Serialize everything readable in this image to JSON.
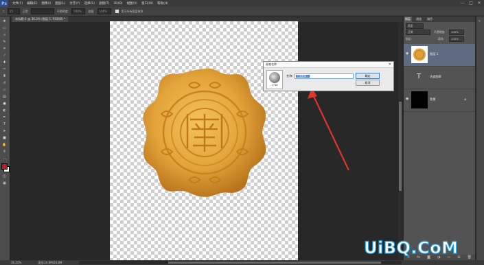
{
  "app": {
    "logo": "Ps"
  },
  "menu": [
    "文件(F)",
    "编辑(E)",
    "图像(I)",
    "图层(L)",
    "文字(Y)",
    "选择(S)",
    "滤镜(T)",
    "3D(D)",
    "视图(V)",
    "窗口(W)",
    "帮助(H)"
  ],
  "window_controls": [
    "—",
    "□",
    "✕"
  ],
  "options_bar": {
    "preset": "15",
    "mode_label": "正常",
    "opacity_label": "不透明度:",
    "opacity_value": "100%",
    "flow_label": "流量:",
    "flow_value": "100%",
    "checkbox_label": "用于所有图层取样"
  },
  "document_tab": {
    "title": "未标题-1 @ 36.2% (图层 1, RGB/8) *"
  },
  "tools": [
    "move",
    "marquee",
    "lasso",
    "quick-select",
    "crop",
    "eyedropper",
    "heal",
    "brush",
    "stamp",
    "history",
    "eraser",
    "gradient",
    "blur",
    "dodge",
    "pen",
    "type",
    "path-select",
    "shape",
    "hand",
    "zoom",
    "more"
  ],
  "colors": {
    "foreground": "#c8141e",
    "background": "#ffffff",
    "arrow": "#e0352b",
    "watermark_stroke": "#1aa0e6"
  },
  "status": {
    "zoom": "36.25%",
    "doc": "文档:24.9M/26.8M"
  },
  "panel": {
    "tabs": [
      "图层",
      "通道",
      "路径"
    ],
    "filter_label": "类型",
    "blend_mode": "正常",
    "opacity_label": "不透明度:",
    "opacity_value": "100%",
    "lock_label": "锁定:",
    "fill_label": "填充:",
    "fill_value": "100%",
    "layers": [
      {
        "name": "图层 1",
        "type": "image",
        "selected": true
      },
      {
        "name": "仿造图章",
        "type": "text",
        "selected": false
      },
      {
        "name": "背景",
        "type": "background",
        "selected": false
      }
    ],
    "bottom_icons": [
      "link-icon",
      "fx-icon",
      "mask-icon",
      "adjust-icon",
      "folder-icon",
      "new-layer-icon",
      "trash-icon"
    ]
  },
  "dialog": {
    "title": "画笔名称",
    "close": "✕",
    "brush_size": "1738",
    "name_label": "名称:",
    "name_value": "仿造图章 1",
    "ok_label": "确定",
    "cancel_label": "取消"
  },
  "watermark": "UiBQ.CoM"
}
